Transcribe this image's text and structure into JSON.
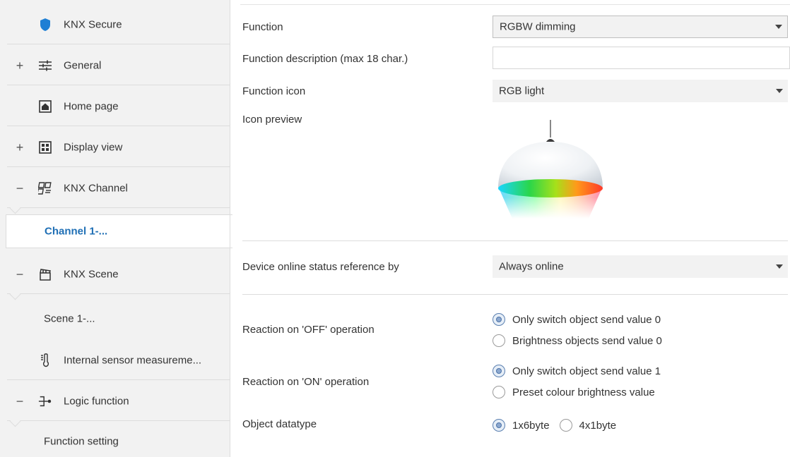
{
  "sidebar": {
    "items": [
      {
        "label": "KNX Secure",
        "icon": "shield-icon",
        "toggle": ""
      },
      {
        "label": "General",
        "icon": "sliders-icon",
        "toggle": "+"
      },
      {
        "label": "Home page",
        "icon": "home-icon",
        "toggle": ""
      },
      {
        "label": "Display view",
        "icon": "grid-icon",
        "toggle": "+"
      },
      {
        "label": "KNX Channel",
        "icon": "channel-icon",
        "toggle": "−"
      },
      {
        "label": "Channel 1-...",
        "icon": "",
        "toggle": ""
      },
      {
        "label": "KNX Scene",
        "icon": "clapperboard-icon",
        "toggle": "−"
      },
      {
        "label": "Scene 1-...",
        "icon": "",
        "toggle": ""
      },
      {
        "label": "Internal sensor measureme...",
        "icon": "thermometer-icon",
        "toggle": ""
      },
      {
        "label": "Logic function",
        "icon": "logic-icon",
        "toggle": "−"
      },
      {
        "label": "Function setting",
        "icon": "",
        "toggle": ""
      }
    ],
    "active_item": "Channel 1-...",
    "accent_color": "#1f6fb5"
  },
  "main": {
    "function": {
      "label": "Function",
      "value": "RGBW dimming"
    },
    "function_description": {
      "label": "Function description (max 18 char.)",
      "value": ""
    },
    "function_icon": {
      "label": "Function icon",
      "value": "RGB light"
    },
    "icon_preview": {
      "label": "Icon preview",
      "icon": "rgb-pendant-lamp-icon"
    },
    "online_status": {
      "label": "Device online status reference by",
      "value": "Always online"
    },
    "reaction_off": {
      "label": "Reaction on 'OFF' operation",
      "options": [
        "Only switch object send value 0",
        "Brightness objects send value 0"
      ],
      "selected": "Only switch object send value 0"
    },
    "reaction_on": {
      "label": "Reaction on 'ON' operation",
      "options": [
        "Only switch object send value 1",
        "Preset colour brightness value"
      ],
      "selected": "Only switch object send value 1"
    },
    "object_datatype": {
      "label": "Object datatype",
      "options": [
        "1x6byte",
        "4x1byte"
      ],
      "selected": "1x6byte"
    }
  }
}
